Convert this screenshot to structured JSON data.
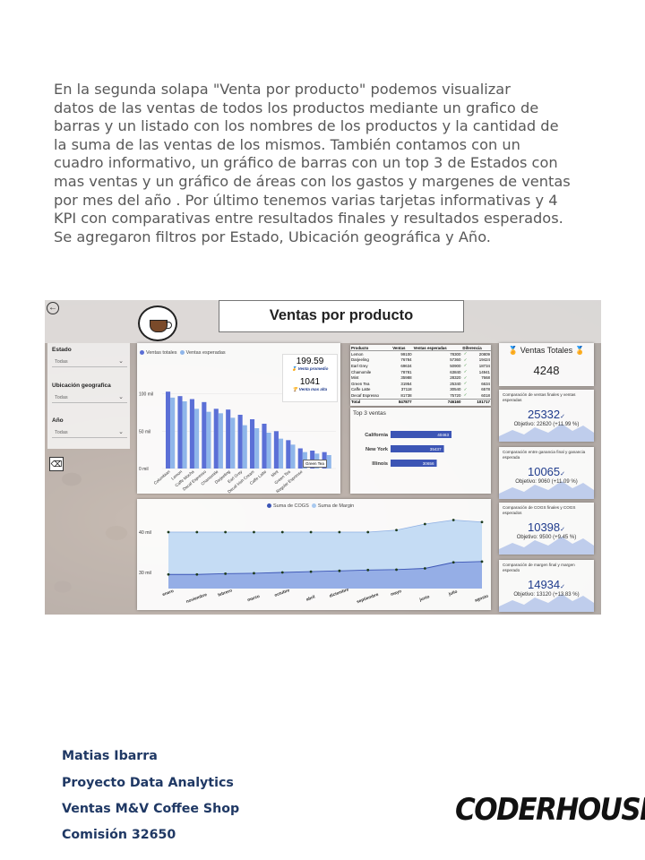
{
  "intro_text": "En la segunda solapa \"Venta por producto\" podemos visualizar\ndatos de las ventas de todos los productos mediante un grafico de\nbarras y un listado con los nombres de los productos y la cantidad de\nla suma de las ventas de los mismos. También contamos con un\ncuadro informativo, un gráfico de barras con un top 3 de Estados con\nmas ventas y un gráfico de áreas con los gastos y margenes de ventas\npor mes del año . Por último tenemos varias tarjetas informativas y 4\nKPI con comparativas entre resultados finales y resultados esperados.\nSe agregaron filtros por Estado, Ubicación geográfica y Año.",
  "dashboard": {
    "title": "Ventas por producto",
    "filters": [
      {
        "label": "Estado",
        "value": "Todas"
      },
      {
        "label": "Ubicación geografica",
        "value": "Todas"
      },
      {
        "label": "Año",
        "value": "Todas"
      }
    ],
    "bar_chart": {
      "legend": [
        "Ventas totales",
        "Ventas esperadas"
      ],
      "colors": {
        "totales": "#5b6fd6",
        "esperadas": "#8fb6ea"
      },
      "y_ticks": [
        "100 mil",
        "50 mil",
        "0 mil"
      ],
      "info_box": [
        {
          "value": "199.59",
          "label": "Venta promedio"
        },
        {
          "value": "1041",
          "label": "Venta mas alta"
        }
      ],
      "tooltip": "Green Tea"
    },
    "product_table": {
      "headers": [
        "Producto",
        "Ventas",
        "Ventas esperadas",
        "Diferencia"
      ],
      "rows": [
        [
          "Lemon",
          "99100",
          "78300",
          "20809"
        ],
        [
          "Darjeeling",
          "76784",
          "57360",
          "19424"
        ],
        [
          "Earl Grey",
          "69634",
          "50900",
          "18734"
        ],
        [
          "Chamomile",
          "78781",
          "63840",
          "14941"
        ],
        [
          "Mint",
          "35988",
          "28320",
          "7668"
        ],
        [
          "Green Tea",
          "31954",
          "25340",
          "6634"
        ],
        [
          "Caffe Latte",
          "37118",
          "30540",
          "6578"
        ],
        [
          "Decaf Espresso",
          "81738",
          "75720",
          "6018"
        ]
      ],
      "total": [
        "Total",
        "847877",
        "746160",
        "101717"
      ]
    },
    "top3": {
      "title": "Top 3 ventas",
      "states": [
        "California",
        "New York",
        "Illinois"
      ],
      "values": [
        "40463",
        "35437",
        "30656"
      ]
    },
    "area_chart": {
      "legend": [
        "Suma de COGS",
        "Suma de Margin"
      ],
      "y_ticks": [
        "40 mil",
        "30 mil"
      ],
      "months": [
        "enero",
        "noviembre",
        "febrero",
        "marzo",
        "octubre",
        "abril",
        "diciembre",
        "septiembre",
        "mayo",
        "junio",
        "julio",
        "agosto"
      ]
    },
    "kpi_total": {
      "title": "Ventas Totales",
      "value": "4248"
    },
    "kpis": [
      {
        "title": "Comparación de ventas finales y ventas esperadas",
        "value": "25332",
        "goal": "Objetivo: 22620 (+11.99 %)"
      },
      {
        "title": "Comparación entre ganancia final y ganancia esperada",
        "value": "10065",
        "goal": "Objetivo: 9060 (+11.09 %)"
      },
      {
        "title": "Comparación de COGS finales y COGS esperados",
        "value": "10398",
        "goal": "Objetivo: 9500 (+9.45 %)"
      },
      {
        "title": "Comparación de margen final y margen esperado",
        "value": "14934",
        "goal": "Objetivo: 13120 (+13.83 %)"
      }
    ]
  },
  "chart_data": [
    {
      "type": "bar",
      "series": [
        {
          "name": "Ventas totales",
          "values": [
            103,
            97,
            93,
            89,
            80,
            79,
            72,
            66,
            60,
            50,
            38,
            27,
            24,
            22
          ]
        },
        {
          "name": "Ventas esperadas",
          "values": [
            95,
            90,
            80,
            76,
            74,
            68,
            58,
            54,
            48,
            40,
            32,
            22,
            20,
            18
          ]
        }
      ],
      "categories": [
        "Columbian",
        "Lemon",
        "Caffe Mocha",
        "Decaf Espresso",
        "Chamomile",
        "Darjeeling",
        "Earl Grey",
        "Decaf Irish Cream",
        "Caffe Latte",
        "Mint",
        "Green Tea",
        "Regular Espresso",
        "",
        ""
      ],
      "ylim": [
        0,
        120
      ]
    },
    {
      "type": "bar",
      "categories": [
        "California",
        "New York",
        "Illinois"
      ],
      "values": [
        40463,
        35437,
        30656
      ]
    },
    {
      "type": "area",
      "categories": [
        "enero",
        "noviembre",
        "febrero",
        "marzo",
        "octubre",
        "abril",
        "diciembre",
        "septiembre",
        "mayo",
        "junio",
        "julio",
        "agosto"
      ],
      "series": [
        {
          "name": "Suma de Margin",
          "values": [
            40,
            40,
            40,
            40,
            40,
            40,
            40,
            40,
            40.5,
            42,
            43,
            42.5
          ]
        },
        {
          "name": "Suma de COGS",
          "values": [
            29.5,
            29.5,
            29.7,
            29.8,
            30,
            30.2,
            30.4,
            30.6,
            30.7,
            31,
            32.5,
            32.7
          ]
        }
      ],
      "ylim": [
        26,
        46
      ]
    }
  ],
  "author": [
    "Matias Ibarra",
    "Proyecto Data Analytics",
    "Ventas M&V Coffee Shop",
    "Comisión 32650"
  ],
  "brand": "CODERHOUSE"
}
